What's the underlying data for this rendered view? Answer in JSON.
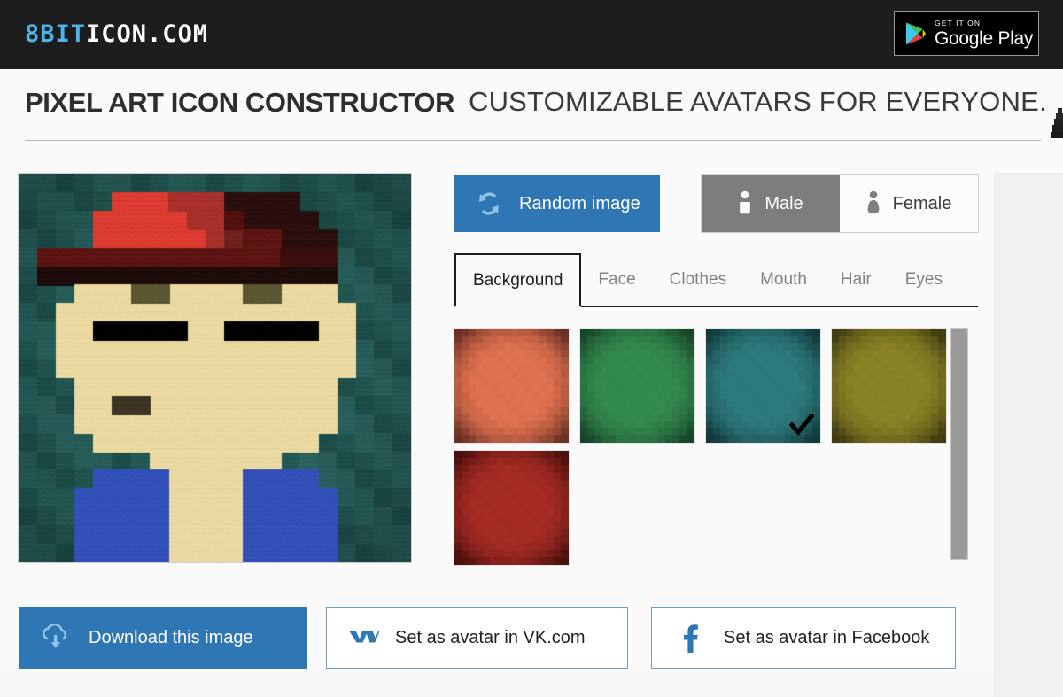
{
  "site": {
    "logo_blue": "8BIT",
    "logo_white": "ICON.COM",
    "logo_blue_color": "#4eb3e8"
  },
  "store_badge": {
    "name": "google-play-badge",
    "small_label": "GET IT ON",
    "big_label": "Google Play"
  },
  "heading": {
    "title": "PIXEL ART ICON CONSTRUCTOR",
    "tagline": "CUSTOMIZABLE AVATARS FOR EVERYONE."
  },
  "preview": {
    "alt": "pixel art avatar preview"
  },
  "controls": {
    "random_label": "Random image",
    "random_icon": "refresh-icon",
    "random_color": "#2e76b4",
    "gender": {
      "selected": "Male",
      "options": [
        {
          "label": "Male",
          "icon": "male-person-icon",
          "active": true
        },
        {
          "label": "Female",
          "icon": "female-person-icon",
          "active": false
        }
      ]
    }
  },
  "tabs": {
    "active": "Background",
    "items": [
      {
        "label": "Background",
        "active": true
      },
      {
        "label": "Face",
        "active": false
      },
      {
        "label": "Clothes",
        "active": false
      },
      {
        "label": "Mouth",
        "active": false
      },
      {
        "label": "Hair",
        "active": false
      },
      {
        "label": "Eyes",
        "active": false
      }
    ]
  },
  "swatches": {
    "selected_index": 2,
    "check_icon": "checkmark-icon",
    "items": [
      {
        "name": "background-orange",
        "color": "#e0724f",
        "edge": "#6b3125",
        "selected": false
      },
      {
        "name": "background-green",
        "color": "#338a4e",
        "edge": "#18452a",
        "selected": false
      },
      {
        "name": "background-teal",
        "color": "#2d7a7c",
        "edge": "#123a3c",
        "selected": true
      },
      {
        "name": "background-olive",
        "color": "#8a8225",
        "edge": "#413c11",
        "selected": false
      },
      {
        "name": "background-darkred",
        "color": "#a62b24",
        "edge": "#4b100d",
        "selected": false
      }
    ]
  },
  "actions": [
    {
      "name": "download-button",
      "label": "Download this image",
      "icon": "download-cloud-icon",
      "style": "primary"
    },
    {
      "name": "vk-avatar-button",
      "label": "Set as avatar in VK.com",
      "icon": "vk-icon",
      "style": "outline"
    },
    {
      "name": "facebook-avatar-button",
      "label": "Set as avatar in Facebook",
      "icon": "facebook-icon",
      "style": "outline"
    }
  ],
  "avatar_art": {
    "grid": 21,
    "palette": {
      "bg_a": "#2b6460",
      "bg_b": "#255954",
      "bg_c": "#1f4f4b",
      "bg_d": "#2a605c",
      "skin": "#ead9a0",
      "skin_edge": "#b9a673",
      "hat_red": "#dc3b31",
      "hat_red_dark": "#a8302a",
      "hat_brim": "#5c1512",
      "hat_band": "#1f0d0c",
      "hat_black": "#2a0f0e",
      "brow": "#000000",
      "mouth": "#3a3623",
      "shadow_patch": "#5a5632",
      "clothes": "#3350b8"
    }
  }
}
